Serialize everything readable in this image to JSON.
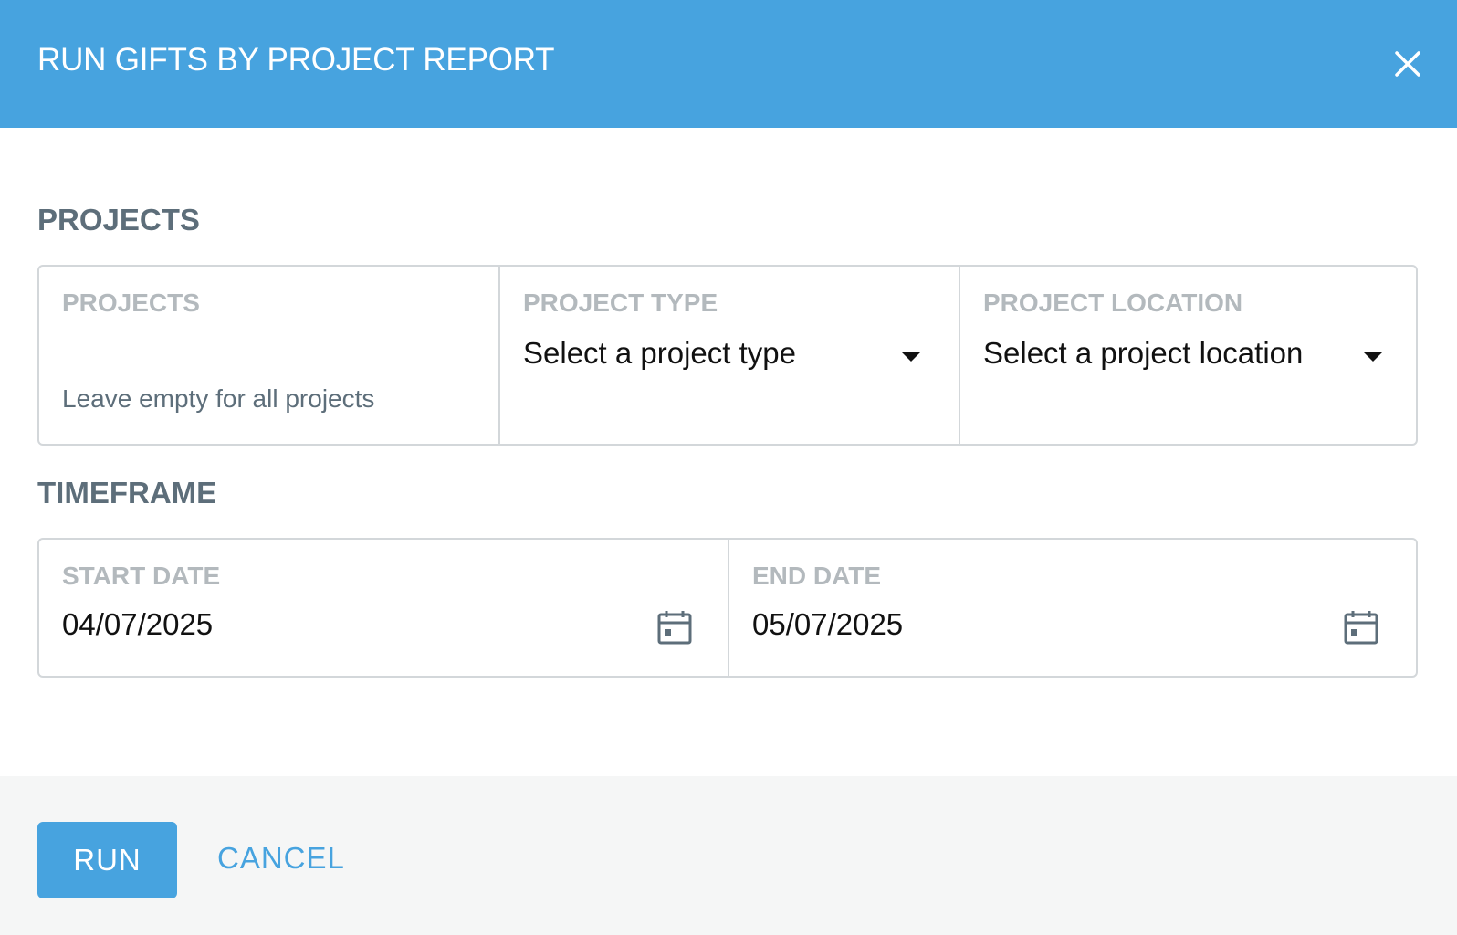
{
  "dialog": {
    "title": "RUN GIFTS BY PROJECT REPORT"
  },
  "projects_section": {
    "heading": "PROJECTS",
    "projects_field": {
      "label": "PROJECTS",
      "value": "",
      "hint": "Leave empty for all projects"
    },
    "project_type_field": {
      "label": "PROJECT TYPE",
      "selected": "Select a project type"
    },
    "project_location_field": {
      "label": "PROJECT LOCATION",
      "selected": "Select a project location"
    }
  },
  "timeframe_section": {
    "heading": "TIMEFRAME",
    "start_date": {
      "label": "START DATE",
      "value": "04/07/2025",
      "icon": "calendar-icon"
    },
    "end_date": {
      "label": "END DATE",
      "value": "05/07/2025",
      "icon": "calendar-icon"
    }
  },
  "footer": {
    "run_label": "RUN",
    "cancel_label": "CANCEL"
  },
  "colors": {
    "accent": "#47a3df",
    "heading": "#5d6e7a",
    "label": "#b3b9bd",
    "border": "#d3d7da",
    "footer_bg": "#f5f6f6"
  }
}
